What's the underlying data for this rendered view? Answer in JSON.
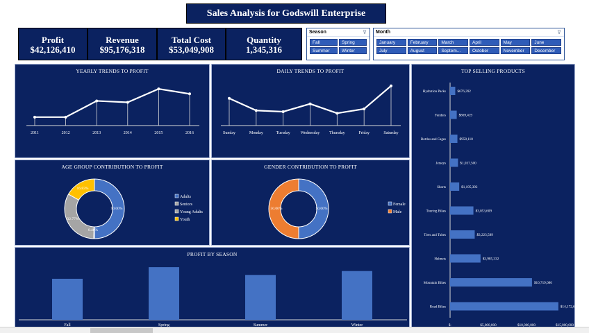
{
  "title": "Sales Analysis for Godswill Enterprise",
  "kpis": [
    {
      "label": "Profit",
      "value": "$42,126,410"
    },
    {
      "label": "Revenue",
      "value": "$95,176,318"
    },
    {
      "label": "Total Cost",
      "value": "$53,049,908"
    },
    {
      "label": "Quantity",
      "value": "1,345,316"
    }
  ],
  "slicers": {
    "season": {
      "title": "Season",
      "items": [
        "Fall",
        "Spring",
        "Summer",
        "Winter"
      ]
    },
    "month": {
      "title": "Month",
      "items": [
        "January",
        "February",
        "March",
        "April",
        "May",
        "June",
        "July",
        "August",
        "Septem...",
        "October",
        "November",
        "December"
      ]
    }
  },
  "colors": {
    "panel": "#0b2260",
    "bar": "#4472c4",
    "gray": "#a5a5a5",
    "gold": "#ffc000",
    "orange": "#ed7d31",
    "line": "#ffffff"
  },
  "chart_data": [
    {
      "type": "line",
      "title": "YEARLY TRENDS TO PROFIT",
      "x": [
        "2011",
        "2012",
        "2013",
        "2014",
        "2015",
        "2016"
      ],
      "values": [
        2.0,
        2.0,
        6.6,
        6.2,
        10.0,
        8.6
      ],
      "ylim": [
        0,
        12
      ]
    },
    {
      "type": "line",
      "title": "DAILY TRENDS TO PROFIT",
      "x": [
        "Sunday",
        "Monday",
        "Tuesday",
        "Wednesday",
        "Thursday",
        "Friday",
        "Saturday"
      ],
      "values": [
        6.16,
        5.85,
        5.82,
        6.02,
        5.78,
        5.89,
        6.48
      ],
      "ylim": [
        5.5,
        6.6
      ]
    },
    {
      "type": "pie",
      "title": "AGE GROUP CONTRIBUTION TO PROFIT",
      "categories": [
        "Adults",
        "Seniors",
        "Young Adults",
        "Youth"
      ],
      "values": [
        50.0,
        0.4,
        32.77,
        16.83
      ],
      "labels": [
        "50.00%",
        "0.40%",
        "32.77%",
        "16.83%"
      ],
      "legend": "right"
    },
    {
      "type": "pie",
      "title": "GENDER CONTRIBUTION TO PROFIT",
      "categories": [
        "Female",
        "Male"
      ],
      "values": [
        50.0,
        50.0
      ],
      "labels": [
        "50.00%",
        "50.00%"
      ],
      "legend": "right"
    },
    {
      "type": "bar",
      "title": "PROFIT BY SEASON",
      "categories": [
        "Fall",
        "Spring",
        "Summer",
        "Winter"
      ],
      "values": [
        9.5,
        12.2,
        10.4,
        11.3
      ],
      "ylim": [
        0,
        13.5
      ]
    },
    {
      "type": "bar",
      "orientation": "horizontal",
      "title": "TOP SELLING PRODUCTS",
      "categories": [
        "Hydration Packs",
        "Fenders",
        "Bottles and Cages",
        "Jerseys",
        "Shorts",
        "Touring Bikes",
        "Tires and Tubes",
        "Helmets",
        "Mountain Bikes",
        "Road Bikes"
      ],
      "values": [
        676392,
        869419,
        958110,
        1037500,
        1195392,
        3053609,
        3223589,
        3985332,
        10719086,
        14172643
      ],
      "value_labels": [
        "$676,392",
        "$869,419",
        "$958,110",
        "$1,037,500",
        "$1,195,392",
        "$3,053,609",
        "$3,223,589",
        "$3,985,332",
        "$10,719,086",
        "$14,172,643"
      ],
      "xticks": [
        "$-",
        "$5,000,000",
        "$10,000,000",
        "$15,000,000"
      ],
      "xlim": [
        0,
        15000000
      ]
    }
  ]
}
